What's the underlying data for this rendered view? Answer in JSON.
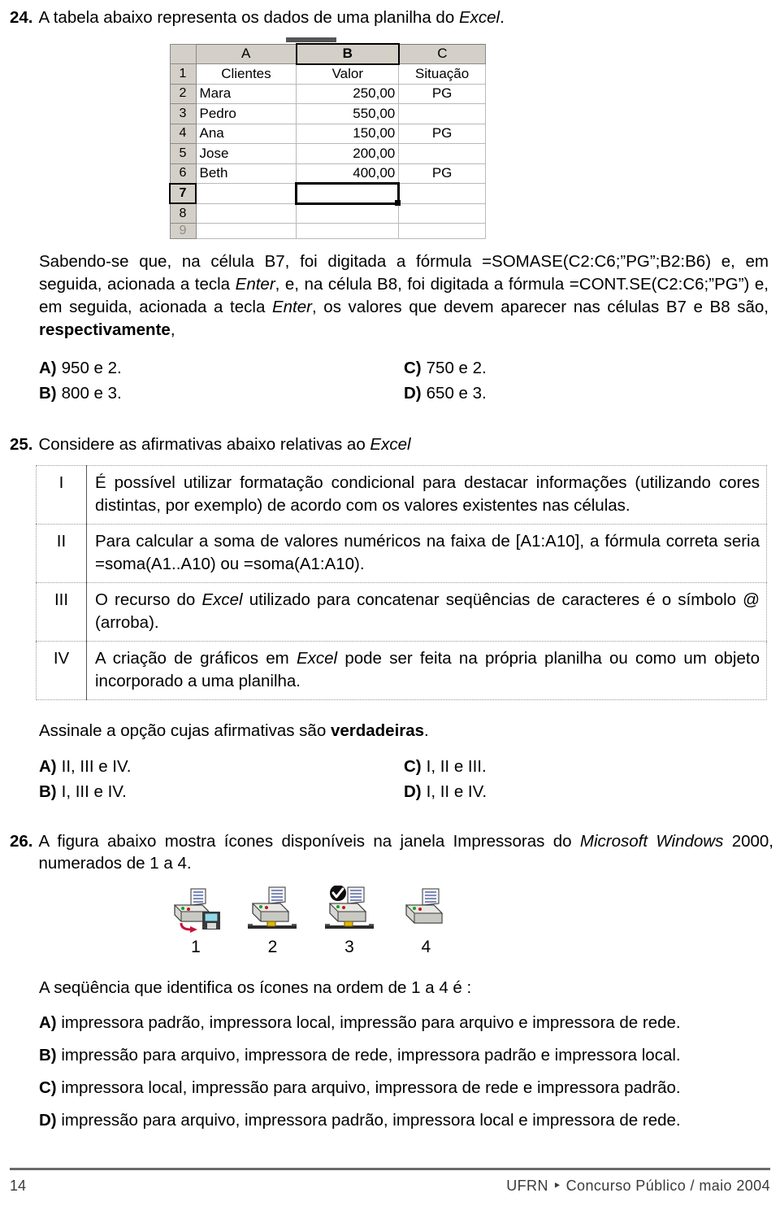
{
  "page": {
    "number": "14",
    "footer_right": "UFRN ‣ Concurso Público / maio 2004"
  },
  "q24": {
    "number": "24.",
    "prompt_before": "A tabela abaixo representa os dados de uma planilha do ",
    "prompt_italic": "Excel",
    "prompt_after": ".",
    "spreadsheet": {
      "columns": [
        "A",
        "B",
        "C"
      ],
      "selected_column": "B",
      "selected_row": "7",
      "selected_cell": "B7",
      "row_headers": [
        "1",
        "2",
        "3",
        "4",
        "5",
        "6",
        "7",
        "8",
        "9"
      ],
      "rows": [
        {
          "num": "1",
          "a": "Clientes",
          "b": "Valor",
          "c": "Situação"
        },
        {
          "num": "2",
          "a": "Mara",
          "b": "250,00",
          "c": "PG"
        },
        {
          "num": "3",
          "a": "Pedro",
          "b": "550,00",
          "c": ""
        },
        {
          "num": "4",
          "a": "Ana",
          "b": "150,00",
          "c": "PG"
        },
        {
          "num": "5",
          "a": "Jose",
          "b": "200,00",
          "c": ""
        },
        {
          "num": "6",
          "a": "Beth",
          "b": "400,00",
          "c": "PG"
        },
        {
          "num": "7",
          "a": "",
          "b": "",
          "c": ""
        },
        {
          "num": "8",
          "a": "",
          "b": "",
          "c": ""
        },
        {
          "num": "9",
          "a": "",
          "b": "",
          "c": ""
        }
      ]
    },
    "statement_p1": "Sabendo-se que, na célula B7, foi digitada a fórmula =SOMASE(C2:C6;”PG”;B2:B6) e, em seguida, acionada a tecla ",
    "statement_i1": "Enter",
    "statement_p2": ", e, na célula B8, foi digitada a fórmula =CONT.SE(C2:C6;”PG”) e, em seguida, acionada a tecla ",
    "statement_i2": "Enter",
    "statement_p3": ", os valores que devem aparecer nas células B7 e B8 são, ",
    "statement_bold": "respectivamente",
    "statement_p4": ",",
    "options": [
      {
        "label": "A)",
        "text": "950  e  2."
      },
      {
        "label": "C)",
        "text": "750  e  2."
      },
      {
        "label": "B)",
        "text": "800  e  3."
      },
      {
        "label": "D)",
        "text": "650  e  3."
      }
    ]
  },
  "q25": {
    "number": "25.",
    "prompt_before": "Considere as afirmativas abaixo relativas ao ",
    "prompt_italic": "Excel",
    "prompt_after": "",
    "statements": [
      {
        "roman": "I",
        "parts": [
          {
            "t": "É possível utilizar formatação condicional para destacar informações (utilizando cores distintas, por exemplo) de acordo com os valores existentes nas células.",
            "style": "normal"
          }
        ]
      },
      {
        "roman": "II",
        "parts": [
          {
            "t": "Para calcular a soma de valores numéricos na faixa de [A1:A10], a fórmula correta seria =soma(A1..A10) ou =soma(A1:A10).",
            "style": "normal"
          }
        ]
      },
      {
        "roman": "III",
        "parts": [
          {
            "t": "O recurso do ",
            "style": "normal"
          },
          {
            "t": "Excel",
            "style": "italic"
          },
          {
            "t": " utilizado para concatenar seqüências de caracteres é o símbolo @ (arroba).",
            "style": "normal"
          }
        ]
      },
      {
        "roman": "IV",
        "parts": [
          {
            "t": "A criação de gráficos em ",
            "style": "normal"
          },
          {
            "t": "Excel",
            "style": "italic"
          },
          {
            "t": " pode ser feita na própria planilha ou como um objeto incorporado a uma planilha.",
            "style": "normal"
          }
        ]
      }
    ],
    "instruction_before": "Assinale a opção cujas afirmativas são ",
    "instruction_bold": "verdadeiras",
    "instruction_after": ".",
    "options": [
      {
        "label": "A)",
        "text": "II, III e IV."
      },
      {
        "label": "C)",
        "text": "I, II e III."
      },
      {
        "label": "B)",
        "text": "I, III e IV."
      },
      {
        "label": "D)",
        "text": "I, II e IV."
      }
    ]
  },
  "q26": {
    "number": "26.",
    "prompt_p1": "A figura abaixo mostra ícones disponíveis na janela Impressoras do ",
    "prompt_i1": "Microsoft Windows",
    "prompt_p2": " 2000, numerados de 1 a 4.",
    "icons": [
      {
        "num": "1",
        "name": "printer-to-file-icon"
      },
      {
        "num": "2",
        "name": "network-printer-icon"
      },
      {
        "num": "3",
        "name": "default-network-printer-icon"
      },
      {
        "num": "4",
        "name": "local-printer-icon"
      }
    ],
    "lead": "A seqüência que identifica os ícones na ordem de 1 a 4 é :",
    "options": [
      {
        "label": "A)",
        "text": "impressora padrão, impressora local, impressão para arquivo e impressora de rede."
      },
      {
        "label": "B)",
        "text": "impressão para arquivo, impressora de rede, impressora padrão e impressora local."
      },
      {
        "label": "C)",
        "text": "impressora local, impressão para arquivo, impressora de rede e impressora padrão."
      },
      {
        "label": "D)",
        "text": "impressão para arquivo, impressora padrão, impressora local e impressora de rede."
      }
    ]
  }
}
